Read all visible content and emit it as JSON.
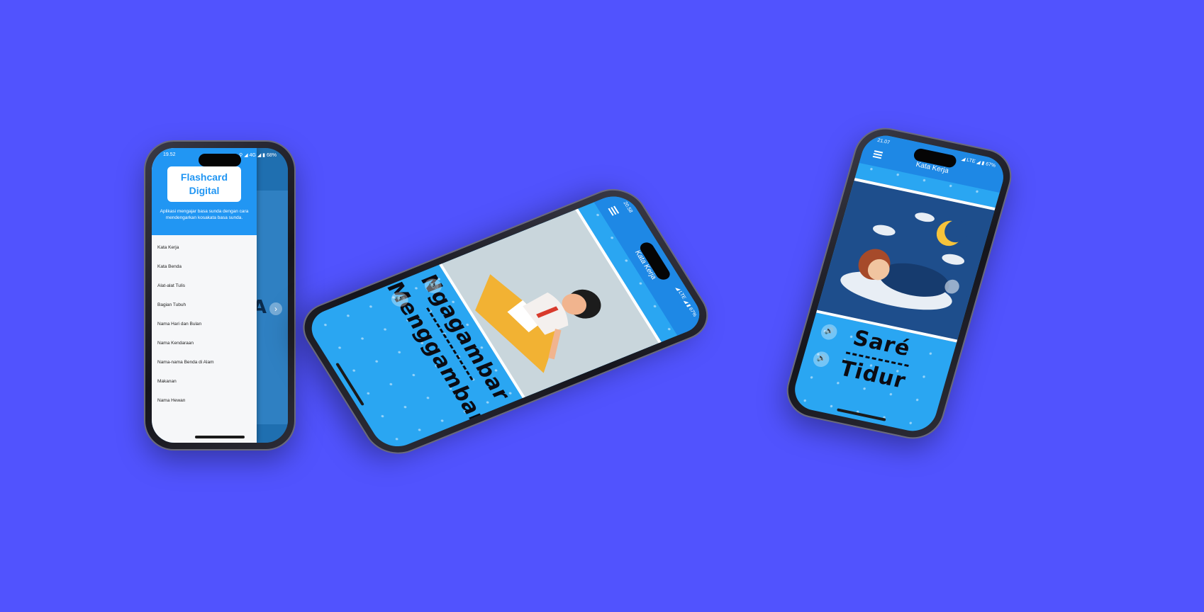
{
  "background_color": "#5153fe",
  "accent_color": "#2196f3",
  "phone1": {
    "status_time": "19.52",
    "status_right": "⚲ ◢ 4G ◢ ▮ 68%",
    "drawer": {
      "title": "Flashcard Digital",
      "description": "Aplikasi mengajar basa sunda dengan cara mendengarkan kosakata basa sunda.",
      "items": [
        {
          "label": "Kata Kerja"
        },
        {
          "label": "Kata Benda"
        },
        {
          "label": "Alat-alat Tulis"
        },
        {
          "label": "Bagian Tubuh"
        },
        {
          "label": "Nama Hari dan Bulan"
        },
        {
          "label": "Nama Kendaraan"
        },
        {
          "label": "Nama-nama Benda di Alam"
        },
        {
          "label": "Makanan"
        },
        {
          "label": "Nama Hewan"
        }
      ]
    },
    "background_letter": "A"
  },
  "phone2": {
    "status_time": "20.58",
    "status_right": "◢ LTE ◢ ▮ 67%",
    "appbar_title": "Kata Kerja",
    "word_sunda": "Ngagambar",
    "word_indonesia": "Menggambar",
    "icon_menu": "menu-icon",
    "icon_sound": "speaker-icon"
  },
  "phone3": {
    "status_time": "21.07",
    "status_right": "◢ LTE ◢ ▮ 67%",
    "appbar_title": "Kata Kerja",
    "word_sunda": "Saré",
    "word_indonesia": "Tidur",
    "icon_menu": "menu-icon",
    "icon_sound": "speaker-icon"
  }
}
